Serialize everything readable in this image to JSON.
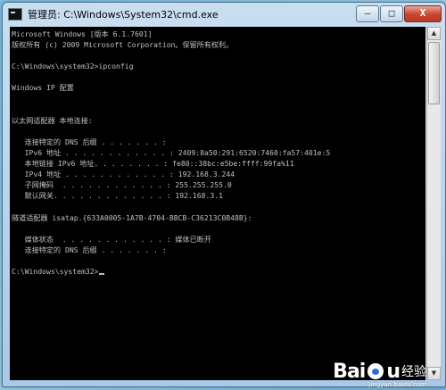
{
  "window": {
    "title": "管理员: C:\\Windows\\System32\\cmd.exe",
    "controls": {
      "minimize": "—",
      "maximize": "□",
      "close": "X"
    }
  },
  "console": {
    "lines": [
      "Microsoft Windows [版本 6.1.7601]",
      "版权所有 (c) 2009 Microsoft Corporation。保留所有权利。",
      "",
      "C:\\Windows\\system32>ipconfig",
      "",
      "Windows IP 配置",
      "",
      "",
      "以太网适配器 本地连接:",
      "",
      "   连接特定的 DNS 后缀 . . . . . . . :",
      "   IPv6 地址 . . . . . . . . . . . . : 2409:8a50:291:6520:7460:fa57:401e:5",
      "   本地链接 IPv6 地址. . . . . . . . : fe80::38bc:e5be:ffff:99fa%11",
      "   IPv4 地址 . . . . . . . . . . . . : 192.168.3.244",
      "   子网掩码  . . . . . . . . . . . . : 255.255.255.0",
      "   默认网关. . . . . . . . . . . . . : 192.168.3.1",
      "",
      "隧道适配器 isatap.{633A0005-1A7B-4704-BBCB-C36213C0B48B}:",
      "",
      "   媒体状态  . . . . . . . . . . . . : 媒体已断开",
      "   连接特定的 DNS 后缀 . . . . . . . :",
      "",
      "C:\\Windows\\system32>"
    ]
  },
  "watermark": {
    "brand": "Bai",
    "brand_end": "u",
    "sub": "经验",
    "url": "jingyan.baidu.com"
  }
}
